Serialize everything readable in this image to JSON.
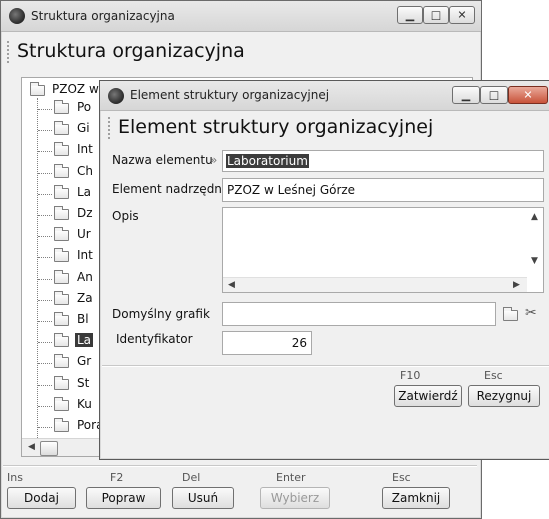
{
  "main_window": {
    "title": "Struktura organizacyjna",
    "header": "Struktura organizacyjna",
    "tree": {
      "root_label": "PZOZ w",
      "items": [
        "Po",
        "Gi",
        "Int",
        "Ch",
        "La",
        "Dz",
        "Ur",
        "Int",
        "An",
        "Za",
        "Bl",
        "La",
        "Gr",
        "St",
        "Ku",
        "Poradnie"
      ],
      "selected_index": 11
    },
    "buttons": [
      {
        "key": "Ins",
        "label": "Dodaj"
      },
      {
        "key": "F2",
        "label": "Popraw"
      },
      {
        "key": "Del",
        "label": "Usuń"
      },
      {
        "key": "Enter",
        "label": "Wybierz"
      },
      {
        "key": "Esc",
        "label": "Zamknij"
      }
    ]
  },
  "dialog": {
    "title": "Element struktury organizacyjnej",
    "header": "Element struktury organizacyjnej",
    "fields": {
      "name_label": "Nazwa elementu",
      "name_marker": "»",
      "name_value": "Laboratorium",
      "parent_label": "Element nadrzędny",
      "parent_value": "PZOZ w Leśnej Górze",
      "desc_label": "Opis",
      "desc_value": "",
      "schedule_label": "Domyślny grafik",
      "schedule_value": "",
      "id_label": "Identyfikator",
      "id_value": "26"
    },
    "buttons": [
      {
        "key": "F10",
        "label": "Zatwierdź"
      },
      {
        "key": "Esc",
        "label": "Rezygnuj"
      }
    ]
  },
  "icons": {
    "minimize": "minimize-icon",
    "maximize": "maximize-icon",
    "close": "close-icon",
    "folder": "folder-icon",
    "browse": "folder-open-icon",
    "clear": "scissors-icon"
  }
}
